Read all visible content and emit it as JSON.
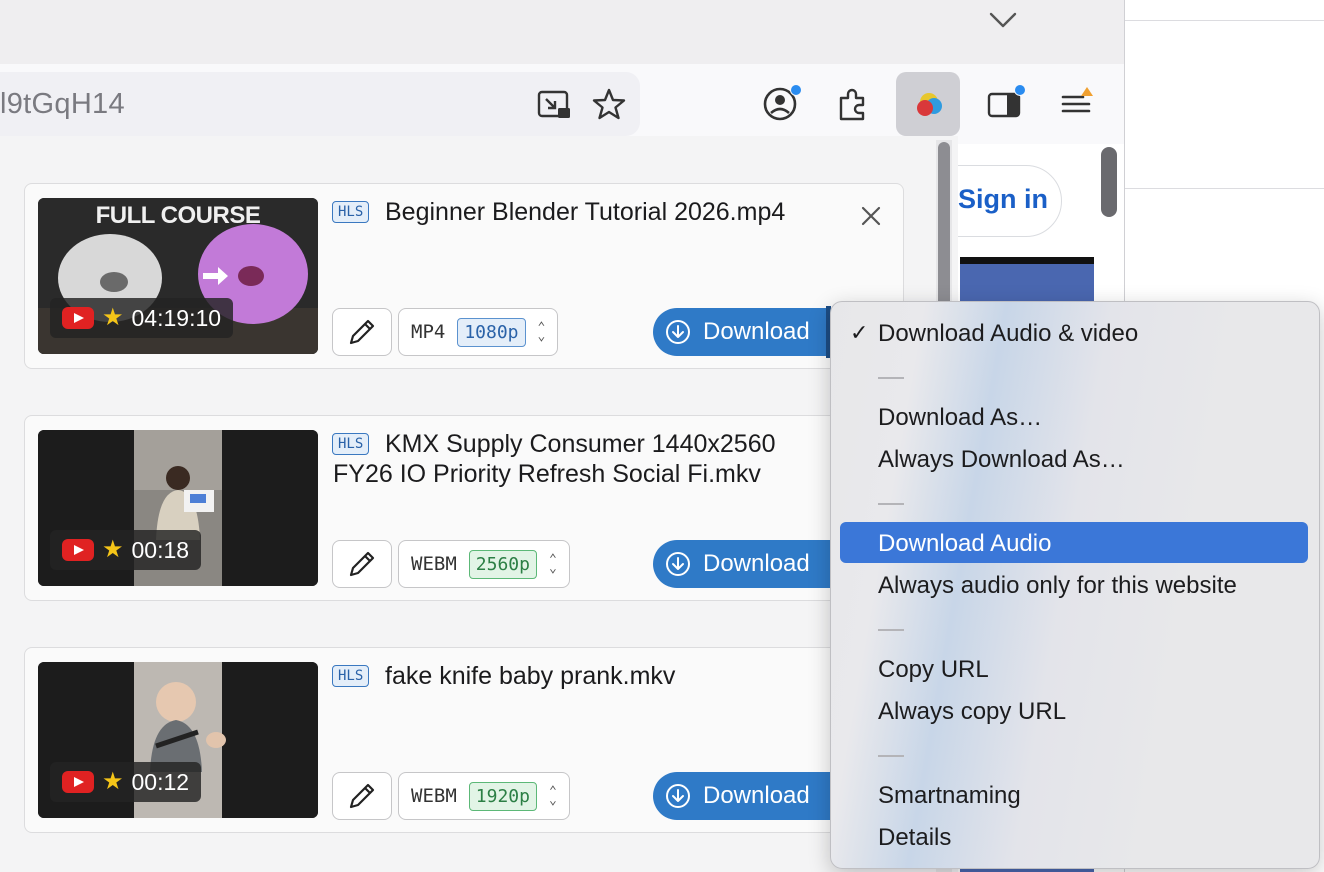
{
  "browser": {
    "url_fragment": "l9tGqH14",
    "icons": [
      "chevron-down-icon",
      "picture-in-picture-icon",
      "bookmark-star-icon",
      "account-icon",
      "extensions-icon",
      "extension-active-icon",
      "sidebar-icon",
      "menu-icon"
    ]
  },
  "page": {
    "sign_in_label": "Sign in"
  },
  "videos": [
    {
      "badge": "HLS",
      "title": "Beginner Blender Tutorial 2026.mp4",
      "thumb_caption": "FULL COURSE",
      "duration": "04:19:10",
      "format": "MP4",
      "resolution": "1080p",
      "download_label": "Download"
    },
    {
      "badge": "HLS",
      "title": "KMX Supply Consumer 1440x2560 FY26 IO Priority Refresh Social Fi.mkv",
      "duration": "00:18",
      "format": "WEBM",
      "resolution": "2560p",
      "download_label": "Download"
    },
    {
      "badge": "HLS",
      "title": "fake knife baby prank.mkv",
      "duration": "00:12",
      "format": "WEBM",
      "resolution": "1920p",
      "download_label": "Download"
    }
  ],
  "menu": {
    "checkmark": "✓",
    "items": [
      "Download Audio & video",
      "Download As…",
      "Always Download As…",
      "Download Audio",
      "Always audio only for this website",
      "Copy URL",
      "Always copy URL",
      "Smartnaming",
      "Details"
    ],
    "highlighted": "Download Audio"
  },
  "colors": {
    "accent": "#2f7ac7",
    "menu_highlight": "#3b77d8",
    "youtube_red": "#e02222"
  }
}
